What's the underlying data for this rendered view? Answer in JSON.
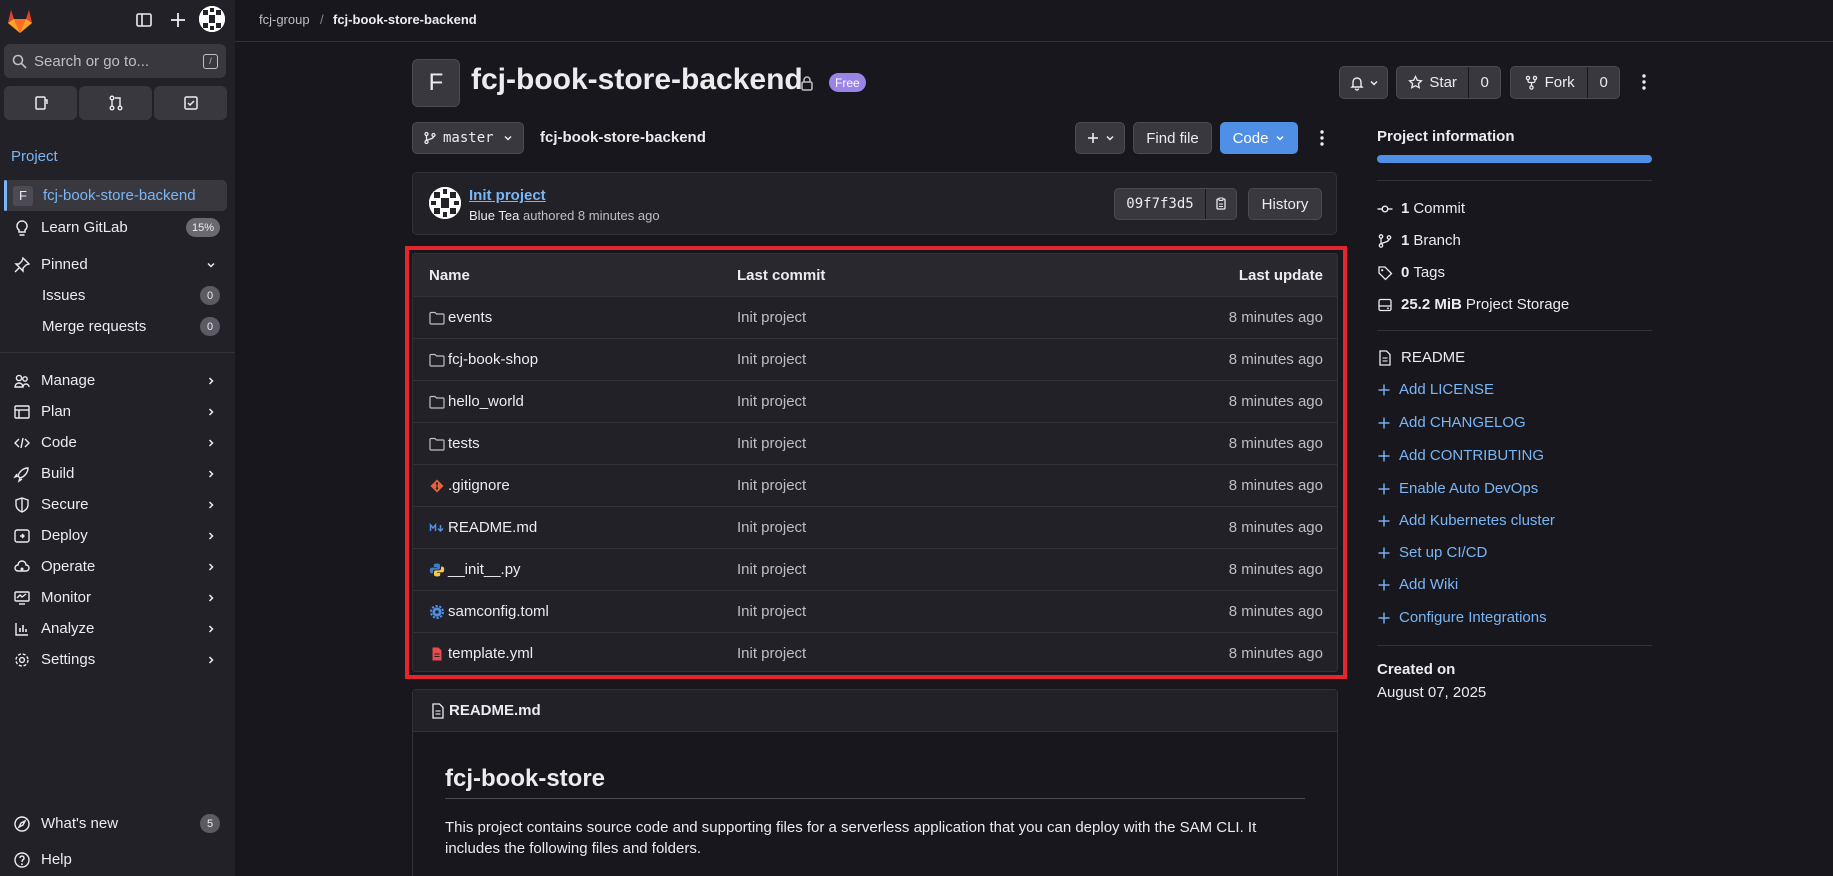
{
  "sidebar": {
    "search_placeholder": "Search or go to...",
    "section_label": "Project",
    "project_badge_letter": "F",
    "project_name": "fcj-book-store-backend",
    "learn_gitlab": {
      "label": "Learn GitLab",
      "progress": "15%"
    },
    "pinned_label": "Pinned",
    "issues": {
      "label": "Issues",
      "count": "0"
    },
    "merge_requests": {
      "label": "Merge requests",
      "count": "0"
    },
    "nav": [
      "Manage",
      "Plan",
      "Code",
      "Build",
      "Secure",
      "Deploy",
      "Operate",
      "Monitor",
      "Analyze",
      "Settings"
    ],
    "whats_new": {
      "label": "What's new",
      "count": "5"
    },
    "help_label": "Help"
  },
  "breadcrumb": {
    "group": "fcj-group",
    "separator": "/",
    "project": "fcj-book-store-backend"
  },
  "project": {
    "avatar_letter": "F",
    "title": "fcj-book-store-backend",
    "visibility_badge": "Free",
    "star_label": "Star",
    "star_count": "0",
    "fork_label": "Fork",
    "fork_count": "0"
  },
  "repo": {
    "branch": "master",
    "path": "fcj-book-store-backend",
    "find_file": "Find file",
    "code_button": "Code"
  },
  "last_commit": {
    "title": "Init project",
    "author": "Blue Tea",
    "meta_rest": "authored 8 minutes ago",
    "sha": "09f7f3d5",
    "history_label": "History"
  },
  "file_table": {
    "headers": {
      "name": "Name",
      "last_commit": "Last commit",
      "last_update": "Last update"
    },
    "rows": [
      {
        "name": "events",
        "icon": "folder-icon",
        "commit": "Init project",
        "updated": "8 minutes ago"
      },
      {
        "name": "fcj-book-shop",
        "icon": "folder-icon",
        "commit": "Init project",
        "updated": "8 minutes ago"
      },
      {
        "name": "hello_world",
        "icon": "folder-icon",
        "commit": "Init project",
        "updated": "8 minutes ago"
      },
      {
        "name": "tests",
        "icon": "folder-icon",
        "commit": "Init project",
        "updated": "8 minutes ago"
      },
      {
        "name": ".gitignore",
        "icon": "git-icon",
        "commit": "Init project",
        "updated": "8 minutes ago"
      },
      {
        "name": "README.md",
        "icon": "markdown-icon",
        "commit": "Init project",
        "updated": "8 minutes ago"
      },
      {
        "name": "__init__.py",
        "icon": "python-icon",
        "commit": "Init project",
        "updated": "8 minutes ago"
      },
      {
        "name": "samconfig.toml",
        "icon": "settings-file-icon",
        "commit": "Init project",
        "updated": "8 minutes ago"
      },
      {
        "name": "template.yml",
        "icon": "yaml-file-icon",
        "commit": "Init project",
        "updated": "8 minutes ago"
      }
    ]
  },
  "readme": {
    "filename": "README.md",
    "heading": "fcj-book-store",
    "paragraph": "This project contains source code and supporting files for a serverless application that you can deploy with the SAM CLI. It includes the following files and folders."
  },
  "project_info": {
    "title": "Project information",
    "stats": [
      {
        "value": "1",
        "label": "Commit",
        "icon": "commit-icon"
      },
      {
        "value": "1",
        "label": "Branch",
        "icon": "branch-icon"
      },
      {
        "value": "0",
        "label": "Tags",
        "icon": "tag-icon"
      },
      {
        "value": "25.2 MiB",
        "label": "Project Storage",
        "icon": "storage-icon"
      }
    ],
    "readme_label": "README",
    "links": [
      "Add LICENSE",
      "Add CHANGELOG",
      "Add CONTRIBUTING",
      "Enable Auto DevOps",
      "Add Kubernetes cluster",
      "Set up CI/CD",
      "Add Wiki",
      "Configure Integrations"
    ],
    "created_on_label": "Created on",
    "created_on_date": "August 07, 2025"
  },
  "colors": {
    "accent_blue": "#4f8fe6",
    "link_blue": "#7ab6f5",
    "highlight_red": "#e3262e",
    "free_badge_purple": "#9a84e8"
  }
}
